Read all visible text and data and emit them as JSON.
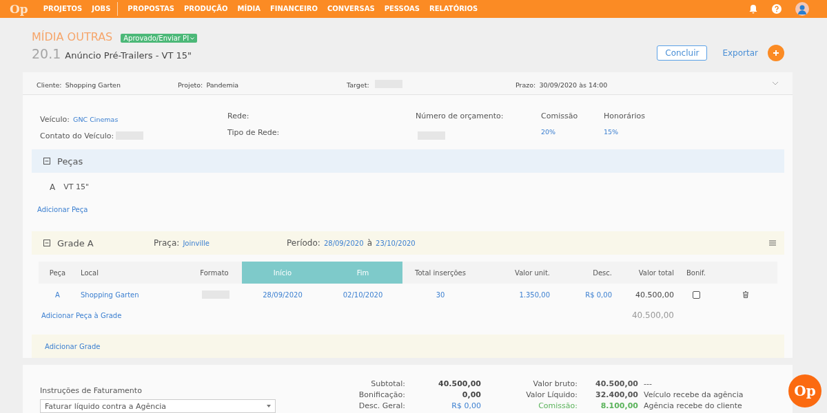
{
  "nav": {
    "logo": "Op",
    "items": [
      {
        "label": "PROJETOS",
        "separator_after": false
      },
      {
        "label": "JOBS",
        "separator_after": true
      },
      {
        "label": "PROPOSTAS",
        "separator_after": false
      },
      {
        "label": "PRODUÇÃO",
        "separator_after": false
      },
      {
        "label": "MÍDIA",
        "separator_after": false
      },
      {
        "label": "FINANCEIRO",
        "separator_after": false
      },
      {
        "label": "CONVERSAS",
        "separator_after": false
      },
      {
        "label": "PESSOAS",
        "separator_after": false
      },
      {
        "label": "RELATÓRIOS",
        "separator_after": false
      }
    ]
  },
  "header": {
    "section": "MÍDIA OUTRAS",
    "status": "Aprovado/Enviar PI",
    "number": "20.1",
    "title": "Anúncio Pré-Trailers - VT 15\"",
    "finish_button": "Concluir",
    "export_link": "Exportar"
  },
  "summary": [
    {
      "label": "Cliente:",
      "value": "Shopping Garten",
      "redacted": false
    },
    {
      "label": "Projeto:",
      "value": "Pandemia",
      "redacted": false
    },
    {
      "label": "Target:",
      "redacted": true
    },
    {
      "label": "Prazo:",
      "value": "30/09/2020 às 14:00",
      "redacted": false
    }
  ],
  "vehicle": {
    "vehicle_label": "Veículo:",
    "vehicle_value": "GNC Cinemas",
    "contact_label": "Contato do Veículo:",
    "network_label": "Rede:",
    "network_type_label": "Tipo de Rede:",
    "budget_label": "Número de orçamento:",
    "commission_label": "Comissão",
    "commission_value": "20%",
    "fees_label": "Honorários",
    "fees_value": "15%"
  },
  "pieces": {
    "title": "Peças",
    "expanded": true,
    "items": [
      {
        "letter": "A",
        "name": "VT 15\""
      }
    ],
    "add_link": "Adicionar Peça"
  },
  "grade": {
    "title": "Grade A",
    "expanded": true,
    "place_label": "Praça:",
    "place_value": "Joinville",
    "period_label": "Período:",
    "period_start": "28/09/2020",
    "period_sep": "à",
    "period_end": "23/10/2020",
    "columns": [
      {
        "label": "Peça",
        "highlighted": false
      },
      {
        "label": "Local",
        "highlighted": false
      },
      {
        "label": "Formato",
        "highlighted": false
      },
      {
        "label": "Início",
        "highlighted": true
      },
      {
        "label": "Fim",
        "highlighted": true
      },
      {
        "label": "Total inserções",
        "highlighted": false
      },
      {
        "label": "Valor unit.",
        "highlighted": false
      },
      {
        "label": "Desc.",
        "highlighted": false
      },
      {
        "label": "Valor total",
        "highlighted": false
      },
      {
        "label": "Bonif.",
        "highlighted": false
      }
    ],
    "rows": [
      {
        "piece": "A",
        "place": "Shopping Garten",
        "start": "28/09/2020",
        "end": "02/10/2020",
        "insertions": "30",
        "unit_value": "1.350,00",
        "discount": "R$ 0,00",
        "total": "40.500,00",
        "bonus": false
      }
    ],
    "add_link": "Adicionar Peça à Grade",
    "total": "40.500,00"
  },
  "add_grade": "Adicionar Grade",
  "chat_button": "Op",
  "billing": {
    "label": "Instruções de Faturamento",
    "value": "Faturar líquido contra a Agência"
  },
  "totals": [
    {
      "label": "Subtotal:",
      "value": "40.500,00",
      "kind": "bold"
    },
    {
      "label": "Bonificação:",
      "value": "0,00",
      "kind": "bold"
    },
    {
      "label": "Desc. Geral:",
      "value": "R$ 0,00",
      "kind": "link"
    }
  ],
  "values": [
    {
      "label": "Valor bruto:",
      "value": "40.500,00",
      "note": "---",
      "kind": "plain"
    },
    {
      "label": "Valor Líquido:",
      "value": "32.400,00",
      "note": "Veículo recebe da agência",
      "kind": "plain"
    },
    {
      "label": "Comissão:",
      "value": "8.100,00",
      "note": "Agência recebe do cliente",
      "kind": "green"
    }
  ]
}
